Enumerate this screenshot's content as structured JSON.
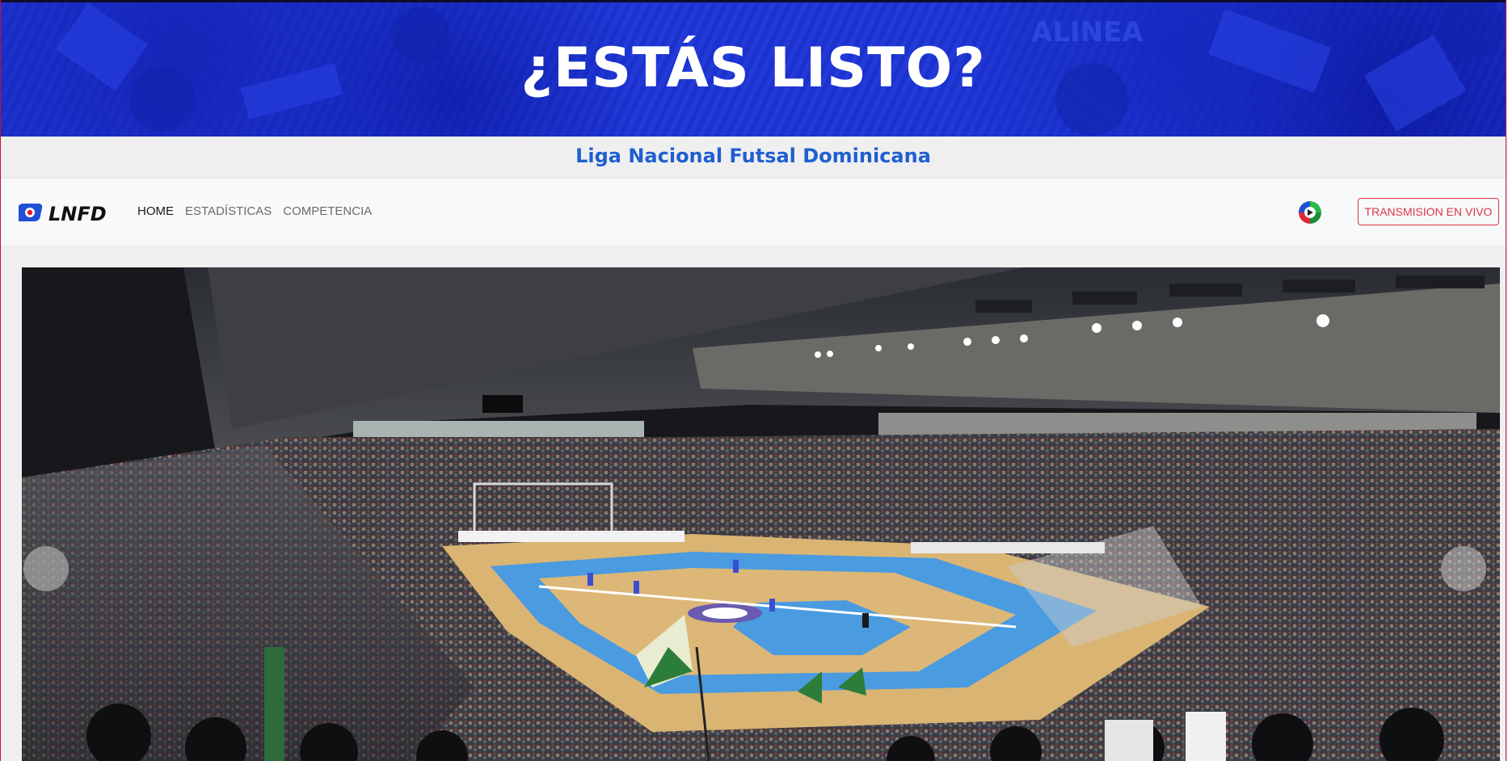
{
  "hero": {
    "title": "¿ESTÁS LISTO?",
    "background_color": "#1c34d6"
  },
  "subtitle_bar": {
    "text": "Liga Nacional Futsal Dominicana",
    "color": "#1f5fd1"
  },
  "navbar": {
    "logo_text": "LNFD",
    "links": [
      {
        "label": "HOME",
        "active": true
      },
      {
        "label": "ESTADÍSTICAS",
        "active": false
      },
      {
        "label": "COMPETENCIA",
        "active": false
      }
    ],
    "channel_icon": "tv-channel-logo-icon",
    "live_button_label": "TRANSMISION EN VIVO",
    "live_button_color": "#dc3545"
  },
  "carousel": {
    "slide_image": "futsal-arena-photo",
    "prev_icon": "chevron-left-icon",
    "next_icon": "chevron-right-icon"
  }
}
